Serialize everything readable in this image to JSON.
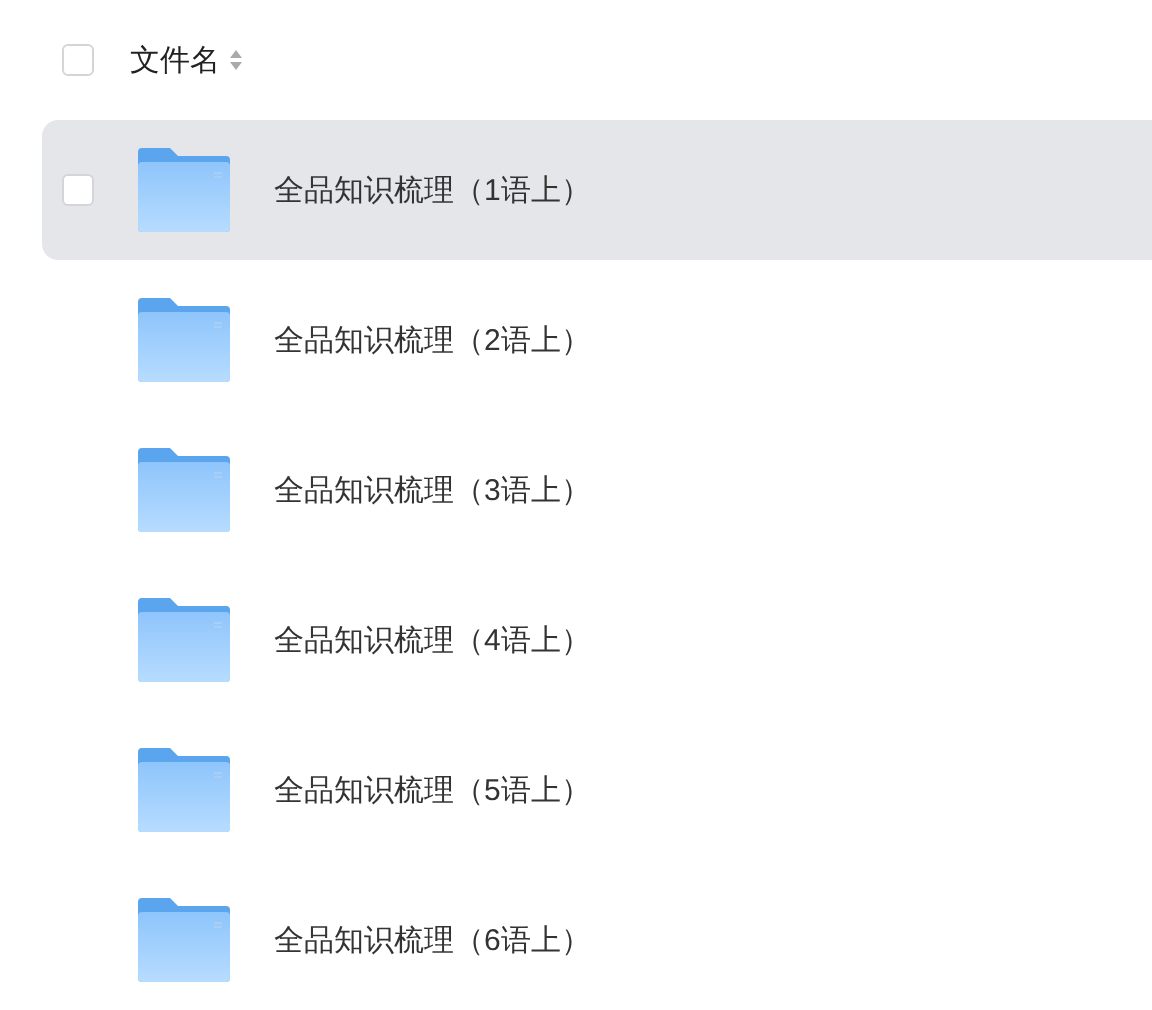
{
  "header": {
    "checked": false,
    "label": "文件名"
  },
  "files": [
    {
      "name": "全品知识梳理（1语上）",
      "hovered": true,
      "checked": false
    },
    {
      "name": "全品知识梳理（2语上）",
      "hovered": false,
      "checked": false
    },
    {
      "name": "全品知识梳理（3语上）",
      "hovered": false,
      "checked": false
    },
    {
      "name": "全品知识梳理（4语上）",
      "hovered": false,
      "checked": false
    },
    {
      "name": "全品知识梳理（5语上）",
      "hovered": false,
      "checked": false
    },
    {
      "name": "全品知识梳理（6语上）",
      "hovered": false,
      "checked": false
    }
  ]
}
